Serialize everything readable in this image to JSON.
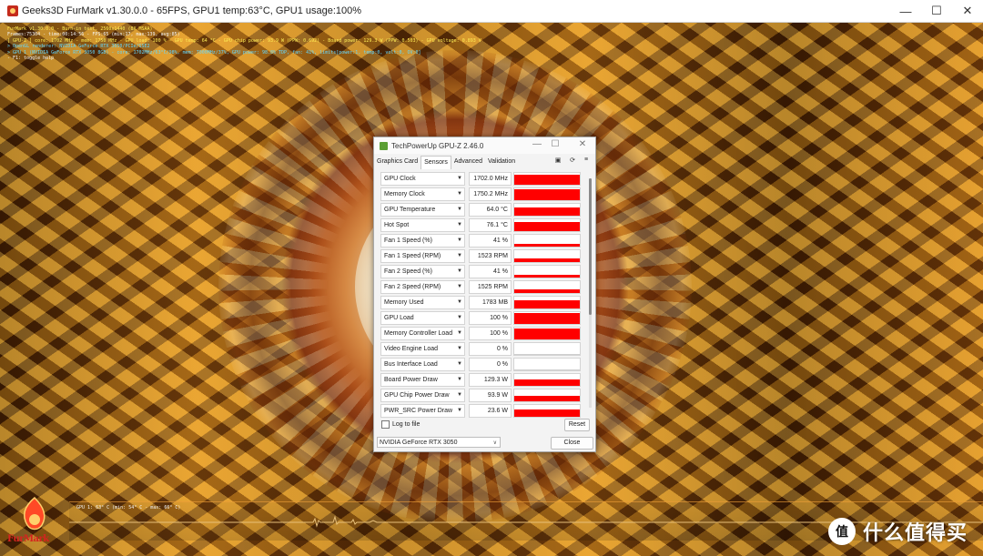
{
  "main_window": {
    "title": "Geeks3D FurMark v1.30.0.0 - 65FPS, GPU1 temp:63°C, GPU1 usage:100%",
    "controls": {
      "minimize": "—",
      "maximize": "☐",
      "close": "✕"
    }
  },
  "overlay": {
    "lines": [
      "FurMark v1.30.0.0 - Burn-in test, 2560x1440 (8X MSAA)",
      "Frames:75304 - time:00:14:56 - FPS:65 (min:17, max:139, avg:85)",
      "[ GPU-Z ] core: 1702 MHz - mem: 1750 MHz - GPU load: 100 % - GPU temp: 64 °C - GPU chip power: 93.9 W (PPW: 0.692) - Board power: 129.3 W (PPW: 0.503) - GPU voltage: 0.893 V",
      "> OpenGL renderer: NVIDIA GeForce RTX 3050/PCIe/SSE2",
      "> GPU 1 (NVIDIA GeForce RTX 3050 8GB) - core: 1702MHz/63°C/98%, mem: 7000MHz/37%, GPU power: 98.8% TDP, fan: 41%, limits[power:1, temp:0, volt:0, OV:0]",
      "- F1: toggle help"
    ]
  },
  "gpuz": {
    "title": "TechPowerUp GPU-Z 2.46.0",
    "controls": {
      "minimize": "—",
      "maximize": "☐",
      "close": "✕"
    },
    "tabs": [
      "Graphics Card",
      "Sensors",
      "Advanced",
      "Validation"
    ],
    "active_tab": "Sensors",
    "tab_icons": [
      "camera-icon",
      "refresh-icon",
      "menu-icon"
    ],
    "sensors": [
      {
        "name": "GPU Clock",
        "value": "1702.0 MHz",
        "level": 0.88
      },
      {
        "name": "Memory Clock",
        "value": "1750.2 MHz",
        "level": 0.9
      },
      {
        "name": "GPU Temperature",
        "value": "64.0 °C",
        "level": 0.72
      },
      {
        "name": "Hot Spot",
        "value": "76.1 °C",
        "level": 0.75
      },
      {
        "name": "Fan 1 Speed (%)",
        "value": "41 %",
        "level": 0.25
      },
      {
        "name": "Fan 1 Speed (RPM)",
        "value": "1523 RPM",
        "level": 0.3
      },
      {
        "name": "Fan 2 Speed (%)",
        "value": "41 %",
        "level": 0.25
      },
      {
        "name": "Fan 2 Speed (RPM)",
        "value": "1525 RPM",
        "level": 0.3
      },
      {
        "name": "Memory Used",
        "value": "1783 MB",
        "level": 0.7
      },
      {
        "name": "GPU Load",
        "value": "100 %",
        "level": 0.92
      },
      {
        "name": "Memory Controller Load",
        "value": "100 %",
        "level": 0.92
      },
      {
        "name": "Video Engine Load",
        "value": "0 %",
        "level": 0.0
      },
      {
        "name": "Bus Interface Load",
        "value": "0 %",
        "level": 0.0
      },
      {
        "name": "Board Power Draw",
        "value": "129.3 W",
        "level": 0.55
      },
      {
        "name": "GPU Chip Power Draw",
        "value": "93.9 W",
        "level": 0.5
      },
      {
        "name": "PWR_SRC Power Draw",
        "value": "23.6 W",
        "level": 0.6
      }
    ],
    "log_label": "Log to file",
    "reset_label": "Reset",
    "gpu_selected": "NVIDIA GeForce RTX 3050",
    "close_label": "Close",
    "bar_color": "#ff0000"
  },
  "graph": {
    "label": "GPU 1: 63° C (min: 54° C - max: 66° C)"
  },
  "logo": {
    "text": "FurMark"
  },
  "watermark": {
    "icon": "值",
    "text": "什么值得买"
  }
}
